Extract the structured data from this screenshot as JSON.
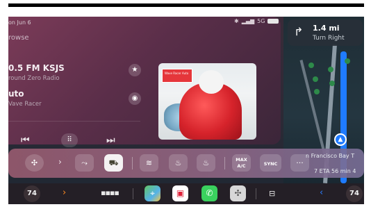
{
  "status": {
    "date": "on Jun 6",
    "signal": "5G",
    "bt_icon": "bluetooth-icon"
  },
  "media": {
    "browse_label": "rowse",
    "stations": [
      {
        "name": "0.5 FM KSJS",
        "subtitle": "round Zero Radio"
      },
      {
        "name": "uto",
        "subtitle": "Vave Racer"
      }
    ],
    "album_art_label": "Wave Racer Auto"
  },
  "navigation": {
    "distance": "1.4 mi",
    "direction": "Turn Right",
    "street": "n Francisco Bay T",
    "eta": "7 ETA",
    "duration": "56 min",
    "extra": "4"
  },
  "climate": {
    "max_ac_line1": "MAX",
    "max_ac_line2": "A/C",
    "sync_label": "SYNC",
    "more_label": "···"
  },
  "dock": {
    "left_temp": "74",
    "right_temp": "74",
    "accent_left": "#ff8a1f",
    "accent_right": "#2a7cff"
  }
}
